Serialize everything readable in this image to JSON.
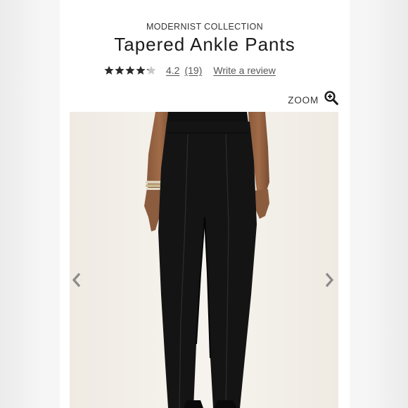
{
  "product": {
    "collection": "MODERNIST COLLECTION",
    "title": "Tapered Ankle Pants",
    "rating": {
      "stars_filled": 4.2,
      "stars_total": 5,
      "value": "4.2",
      "count": "(19)",
      "write_review": "Write a review"
    }
  },
  "gallery": {
    "zoom_label": "ZOOM",
    "zoom_icon": "magnifier-plus-icon",
    "prev_icon": "chevron-left-icon",
    "next_icon": "chevron-right-icon"
  },
  "colors": {
    "star": "#2b2b2b",
    "star_empty": "#c8c8c8",
    "text": "#222222",
    "photo_background": "#f4f1ea",
    "pants": "#141414",
    "arrow": "#8a8a8a"
  }
}
